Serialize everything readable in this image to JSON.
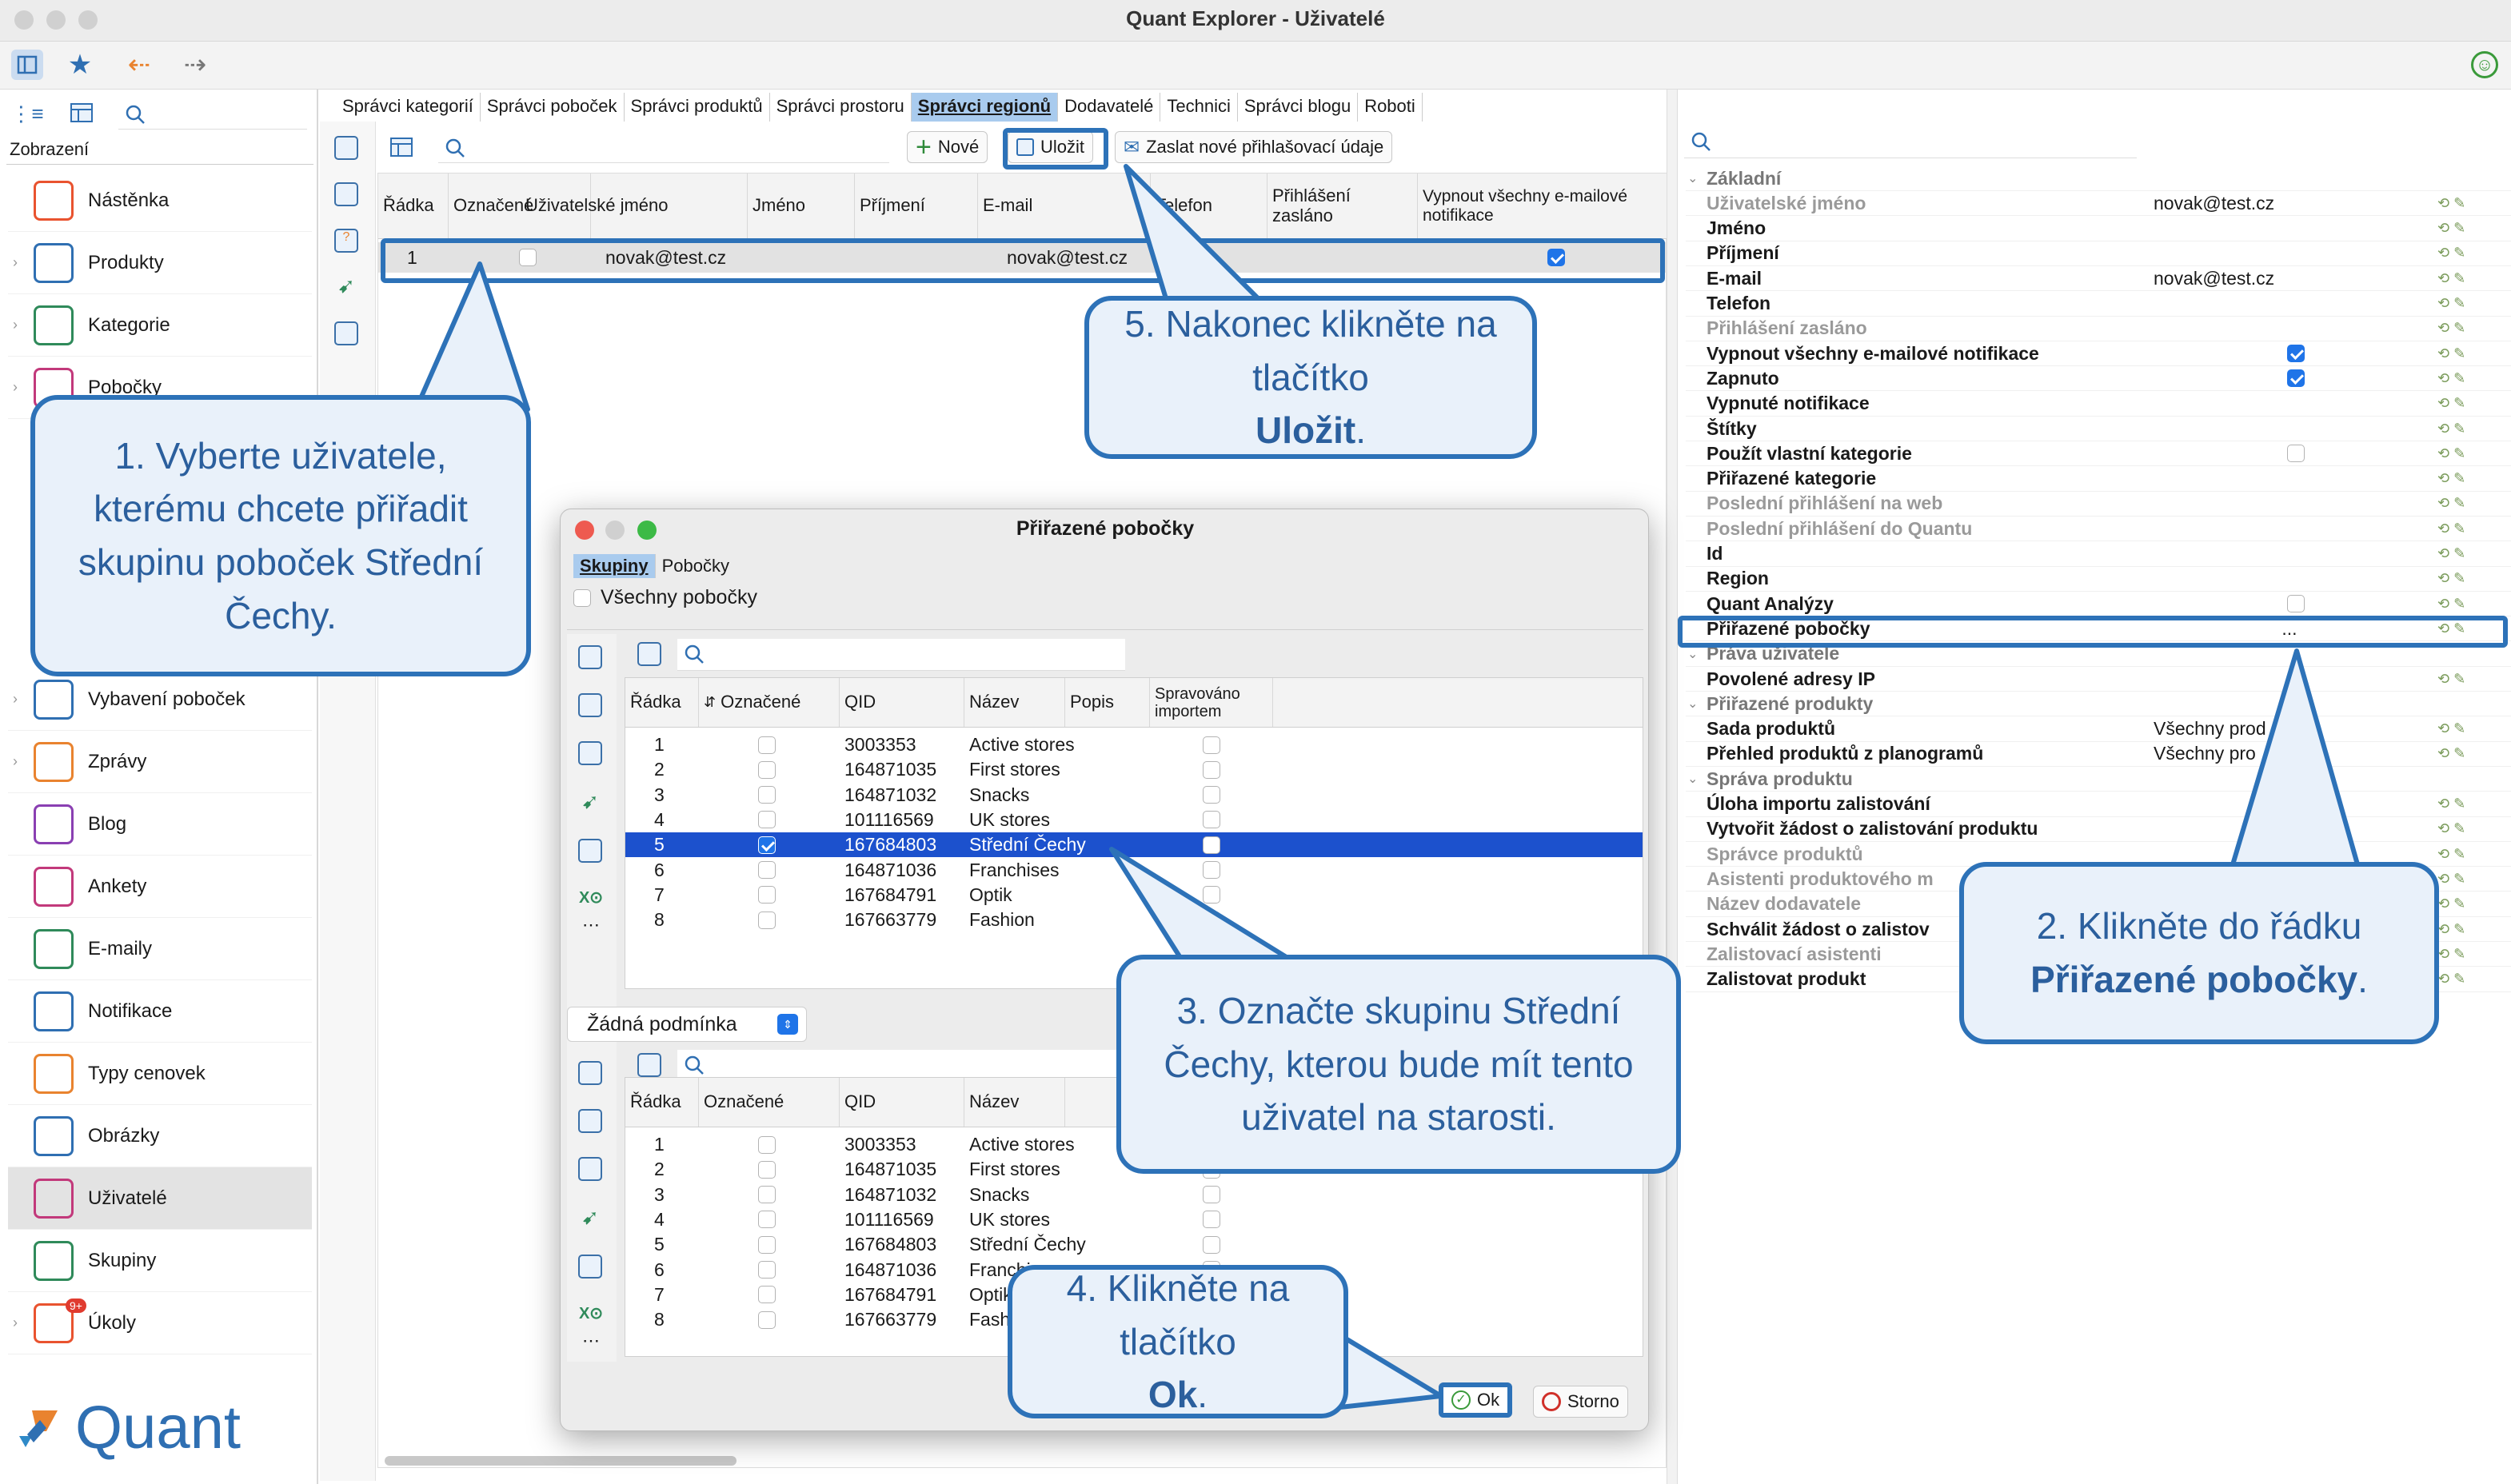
{
  "window": {
    "title": "Quant Explorer - Uživatelé"
  },
  "sidebar": {
    "search_label": "Zobrazení",
    "items": [
      {
        "label": "Nástěnka",
        "color": "#e9532f"
      },
      {
        "label": "Produkty",
        "color": "#2f6fb2"
      },
      {
        "label": "Kategorie",
        "color": "#2f8a5a"
      },
      {
        "label": "Pobočky",
        "color": "#c2397b"
      },
      {
        "label": "Vybavení poboček",
        "color": "#2f6fb2"
      },
      {
        "label": "Zprávy",
        "color": "#e9832f"
      },
      {
        "label": "Blog",
        "color": "#8a3fb2"
      },
      {
        "label": "Ankety",
        "color": "#c2397b"
      },
      {
        "label": "E-maily",
        "color": "#2f8a5a"
      },
      {
        "label": "Notifikace",
        "color": "#2f6fb2"
      },
      {
        "label": "Typy cenovek",
        "color": "#e9832f"
      },
      {
        "label": "Obrázky",
        "color": "#2f6fb2"
      },
      {
        "label": "Uživatelé",
        "color": "#c2397b"
      },
      {
        "label": "Skupiny",
        "color": "#2f8a5a"
      },
      {
        "label": "Úkoly",
        "color": "#e9532f",
        "badge": "9+"
      }
    ],
    "logo": "Quant"
  },
  "tabs": [
    "Správci kategorií",
    "Správci poboček",
    "Správci produktů",
    "Správci prostoru",
    "Správci regionů",
    "Dodavatelé",
    "Technici",
    "Správci blogu",
    "Roboti"
  ],
  "toolbar": {
    "new": "Nové",
    "save": "Uložit",
    "send": "Zaslat nové přihlašovací údaje"
  },
  "users_table": {
    "columns": [
      "Řádka",
      "Označené",
      "Uživatelské jméno",
      "Jméno",
      "Příjmení",
      "E-mail",
      "Telefon",
      "Přihlášení zasláno",
      "Vypnout všechny e-mailové notifikace"
    ],
    "rows": [
      {
        "n": "1",
        "username": "novak@test.cz",
        "email": "novak@test.cz",
        "notif": true
      }
    ]
  },
  "properties": [
    {
      "name": "Základní",
      "type": "section"
    },
    {
      "name": "Uživatelské jméno",
      "value": "novak@test.cz",
      "gray": true
    },
    {
      "name": "Jméno"
    },
    {
      "name": "Příjmení"
    },
    {
      "name": "E-mail",
      "value": "novak@test.cz"
    },
    {
      "name": "Telefon"
    },
    {
      "name": "Přihlášení zasláno",
      "gray": true
    },
    {
      "name": "Vypnout všechny e-mailové notifikace",
      "check": "on"
    },
    {
      "name": "Zapnuto",
      "check": "on"
    },
    {
      "name": "Vypnuté notifikace"
    },
    {
      "name": "Štítky"
    },
    {
      "name": "Použít vlastní kategorie",
      "check": "off"
    },
    {
      "name": "Přiřazené kategorie"
    },
    {
      "name": "Poslední přihlášení na web",
      "gray": true
    },
    {
      "name": "Poslední přihlášení do Quantu",
      "gray": true
    },
    {
      "name": "Id"
    },
    {
      "name": "Region"
    },
    {
      "name": "Quant Analýzy",
      "check": "off"
    },
    {
      "name": "Přiřazené pobočky",
      "value": "..."
    },
    {
      "name": "Práva uživatele",
      "type": "section"
    },
    {
      "name": "Povolené adresy IP"
    },
    {
      "name": "Přiřazené produkty",
      "type": "section"
    },
    {
      "name": "Sada produktů",
      "value": "Všechny prod"
    },
    {
      "name": "Přehled produktů z planogramů",
      "value": "Všechny pro"
    },
    {
      "name": "Správa produktu",
      "type": "section"
    },
    {
      "name": "Úloha importu zalistování"
    },
    {
      "name": "Vytvořit žádost o zalistování produktu"
    },
    {
      "name": "Správce produktů",
      "gray": true
    },
    {
      "name": "Asistenti produktového m",
      "gray": true
    },
    {
      "name": "Název dodavatele",
      "gray": true
    },
    {
      "name": "Schválit žádost o zalistov"
    },
    {
      "name": "Zalistovací asistenti",
      "gray": true
    },
    {
      "name": "Zalistovat produkt"
    }
  ],
  "dialog": {
    "title": "Přiřazené pobočky",
    "tabs": [
      "Skupiny",
      "Pobočky"
    ],
    "all_branches": "Všechny pobočky",
    "top_columns": [
      "Řádka",
      "Označené",
      "QID",
      "Název",
      "Popis",
      "Spravováno importem"
    ],
    "top_rows": [
      {
        "n": "1",
        "qid": "3003353",
        "name": "Active stores"
      },
      {
        "n": "2",
        "qid": "164871035",
        "name": "First stores"
      },
      {
        "n": "3",
        "qid": "164871032",
        "name": "Snacks"
      },
      {
        "n": "4",
        "qid": "101116569",
        "name": "UK stores"
      },
      {
        "n": "5",
        "qid": "167684803",
        "name": "Střední Čechy",
        "selected": true
      },
      {
        "n": "6",
        "qid": "164871036",
        "name": "Franchises"
      },
      {
        "n": "7",
        "qid": "167684791",
        "name": "Optik"
      },
      {
        "n": "8",
        "qid": "167663779",
        "name": "Fashion"
      }
    ],
    "condition": "Žádná podmínka",
    "bottom_columns": [
      "Řádka",
      "Označené",
      "QID",
      "Název"
    ],
    "bottom_rows": [
      {
        "n": "1",
        "qid": "3003353",
        "name": "Active stores"
      },
      {
        "n": "2",
        "qid": "164871035",
        "name": "First stores"
      },
      {
        "n": "3",
        "qid": "164871032",
        "name": "Snacks"
      },
      {
        "n": "4",
        "qid": "101116569",
        "name": "UK stores"
      },
      {
        "n": "5",
        "qid": "167684803",
        "name": "Střední Čechy"
      },
      {
        "n": "6",
        "qid": "164871036",
        "name": "Franchises"
      },
      {
        "n": "7",
        "qid": "167684791",
        "name": "Optik"
      },
      {
        "n": "8",
        "qid": "167663779",
        "name": "Fashion"
      }
    ],
    "ok": "Ok",
    "cancel": "Storno"
  },
  "callouts": {
    "c1": "1. Vyberte uživatele, kterému chcete přiřadit skupinu poboček Střední Čechy.",
    "c2a": "2. Klikněte do řádku",
    "c2b": "Přiřazené pobočky",
    "c3": "3. Označte skupinu Střední Čechy, kterou bude mít tento uživatel na starosti.",
    "c4a": "4. Klikněte na tlačítko",
    "c4b": "Ok",
    "c5a": "5. Nakonec klikněte na tlačítko",
    "c5b": "Uložit"
  }
}
